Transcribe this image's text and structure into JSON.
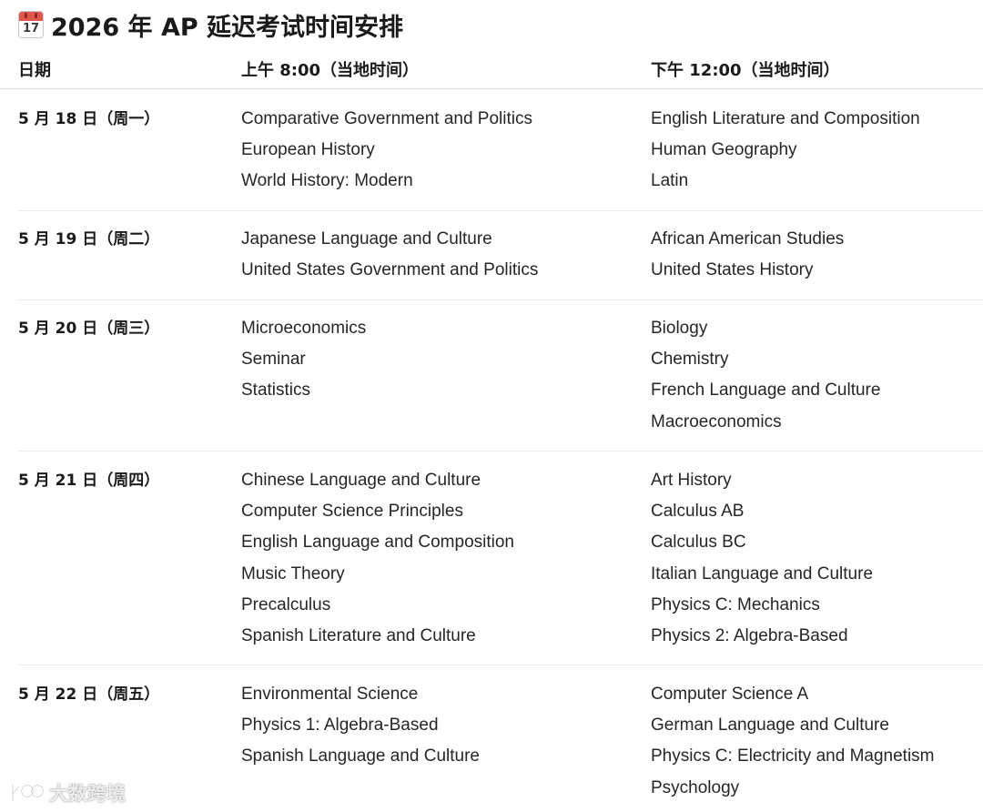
{
  "title": {
    "icon_day": "17",
    "text": "2026 年 AP 延迟考试时间安排"
  },
  "header": {
    "date": "日期",
    "morning": "上午 8:00（当地时间）",
    "afternoon": "下午 12:00（当地时间）"
  },
  "rows": [
    {
      "date": "5 月 18 日（周一）",
      "morning": [
        "Comparative Government and Politics",
        "European History",
        "World History: Modern"
      ],
      "afternoon": [
        "English Literature and Composition",
        "Human Geography",
        "Latin"
      ]
    },
    {
      "date": "5 月 19 日（周二）",
      "morning": [
        "Japanese Language and Culture",
        "United States Government and Politics"
      ],
      "afternoon": [
        "African American Studies",
        "United States History"
      ]
    },
    {
      "date": "5 月 20 日（周三）",
      "morning": [
        "Microeconomics",
        "Seminar",
        "Statistics"
      ],
      "afternoon": [
        "Biology",
        "Chemistry",
        "French Language and Culture",
        "Macroeconomics"
      ]
    },
    {
      "date": "5 月 21 日（周四）",
      "morning": [
        "Chinese Language and Culture",
        "Computer Science Principles",
        "English Language and Composition",
        "Music Theory",
        "Precalculus",
        "Spanish Literature and Culture"
      ],
      "afternoon": [
        "Art History",
        "Calculus AB",
        "Calculus BC",
        "Italian Language and Culture",
        "Physics C: Mechanics",
        "Physics 2: Algebra-Based"
      ]
    },
    {
      "date": "5 月 22 日（周五）",
      "morning": [
        "Environmental Science",
        "Physics 1: Algebra-Based",
        "Spanish Language and Culture"
      ],
      "afternoon": [
        "Computer Science A",
        "German Language and Culture",
        "Physics C: Electricity and Magnetism",
        "Psychology"
      ]
    }
  ],
  "watermark": {
    "logo_text": "K00",
    "text": "大数跨境"
  },
  "colors": {
    "calendar_red": "#e2574c",
    "text": "#262626",
    "divider": "#ececec"
  }
}
